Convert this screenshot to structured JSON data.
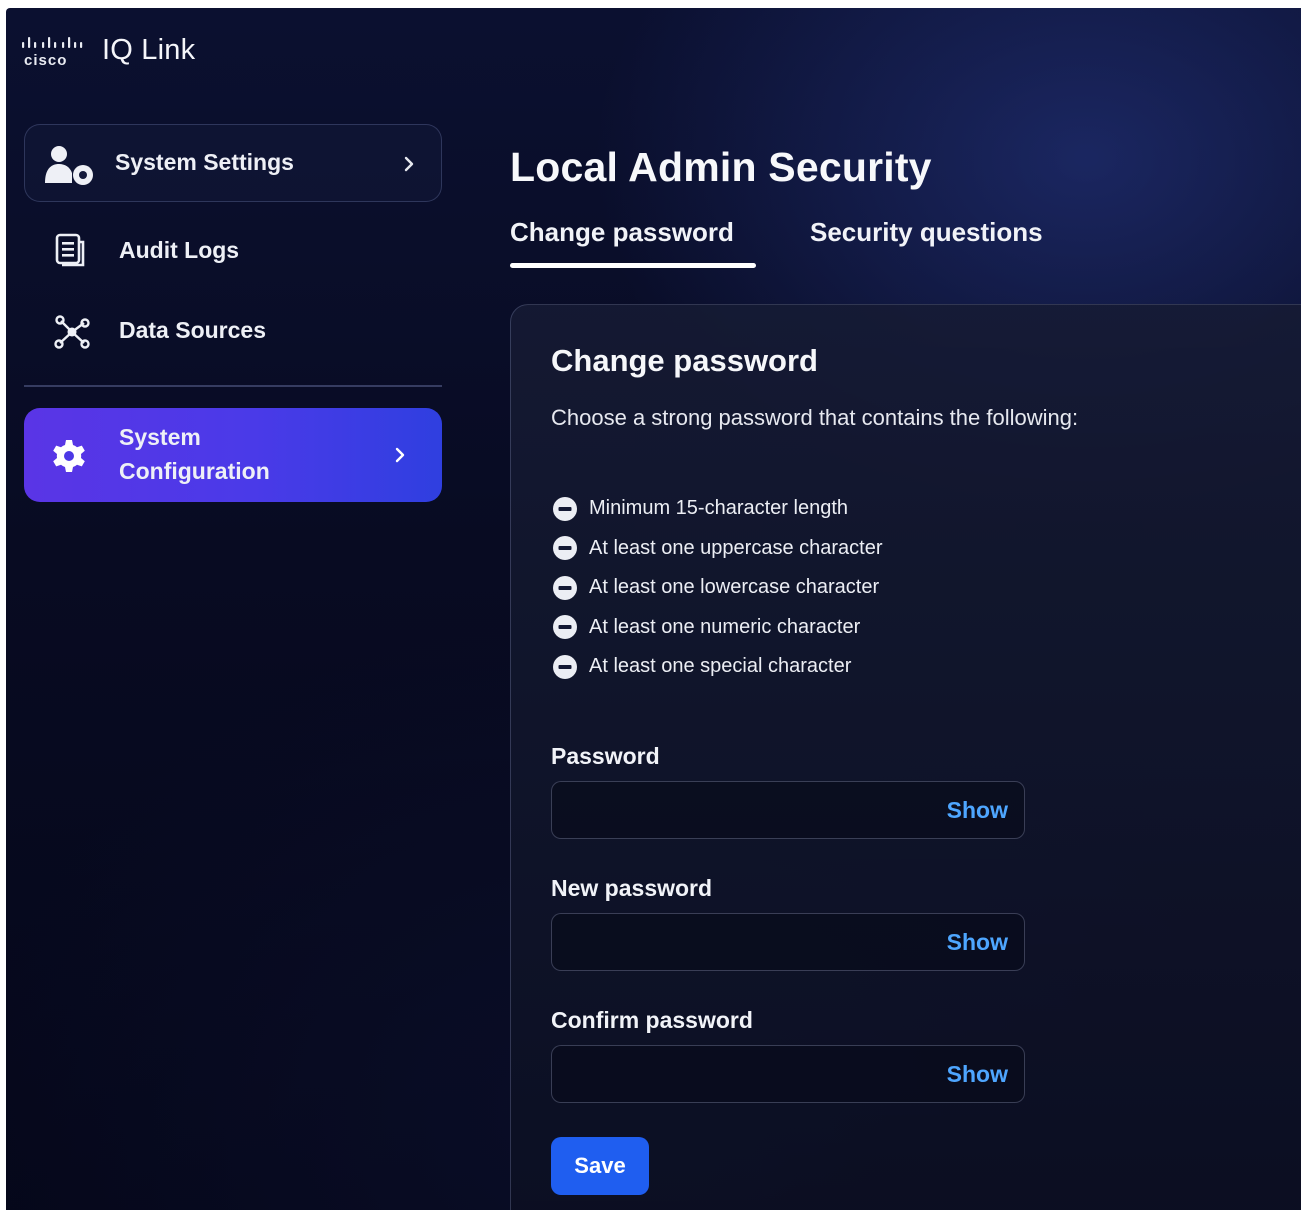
{
  "brand": {
    "logo_icon": "cisco-logo",
    "logo_text": "cisco",
    "product_name": "IQ Link"
  },
  "sidebar": {
    "items": [
      {
        "label": "System Settings",
        "icon": "user-gear-icon",
        "has_chevron": true
      },
      {
        "label": "Audit Logs",
        "icon": "document-icon",
        "has_chevron": false
      },
      {
        "label": "Data Sources",
        "icon": "network-nodes-icon",
        "has_chevron": false
      },
      {
        "label_line1": "System",
        "label_line2": "Configuration",
        "icon": "gear-icon",
        "has_chevron": true,
        "active": true
      }
    ]
  },
  "main": {
    "title": "Local Admin Security",
    "tabs": [
      {
        "label": "Change password",
        "active": true
      },
      {
        "label": "Security questions",
        "active": false
      }
    ],
    "panel": {
      "title": "Change password",
      "description": "Choose a strong password that contains the following:",
      "requirements": [
        "Minimum 15-character length",
        "At least one uppercase character",
        "At least one lowercase character",
        "At least one numeric character",
        "At least one special character"
      ],
      "requirement_icon": "minus-circle-icon",
      "fields": [
        {
          "label": "Password",
          "value": "",
          "toggle_label": "Show"
        },
        {
          "label": "New password",
          "value": "",
          "toggle_label": "Show"
        },
        {
          "label": "Confirm password",
          "value": "",
          "toggle_label": "Show"
        }
      ],
      "save_label": "Save"
    }
  },
  "colors": {
    "active_nav_start": "#5a35e6",
    "active_nav_end": "#2f3fe0",
    "link": "#4ea6ff",
    "primary_button": "#1f5ef0",
    "background": "#080b22"
  }
}
